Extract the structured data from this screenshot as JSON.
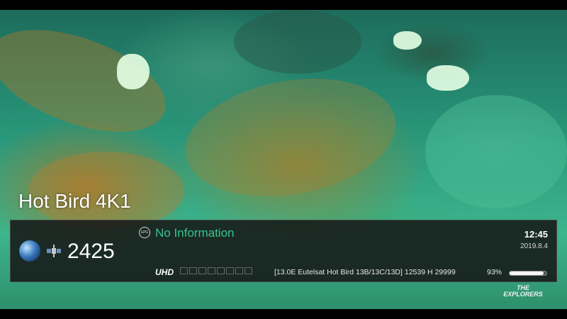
{
  "channel": {
    "name": "Hot Bird 4K1",
    "number": "2425"
  },
  "epg": {
    "icon": "epg-icon",
    "icon_text": "EPG",
    "text": "No Information"
  },
  "clock": {
    "time": "12:45",
    "date": "2019.8.4"
  },
  "stream": {
    "resolution": "UHD",
    "satellite_info": "[13.0E Eutelsat Hot Bird 13B/13C/13D] 12539 H 29999",
    "signal_quality_label": "93%",
    "signal_quality": 0.93
  },
  "watermark": {
    "line1": "THE",
    "line2": "EXPLORERS"
  },
  "colors": {
    "epg_text": "#38c48a",
    "infobar_bg": "#161818"
  }
}
